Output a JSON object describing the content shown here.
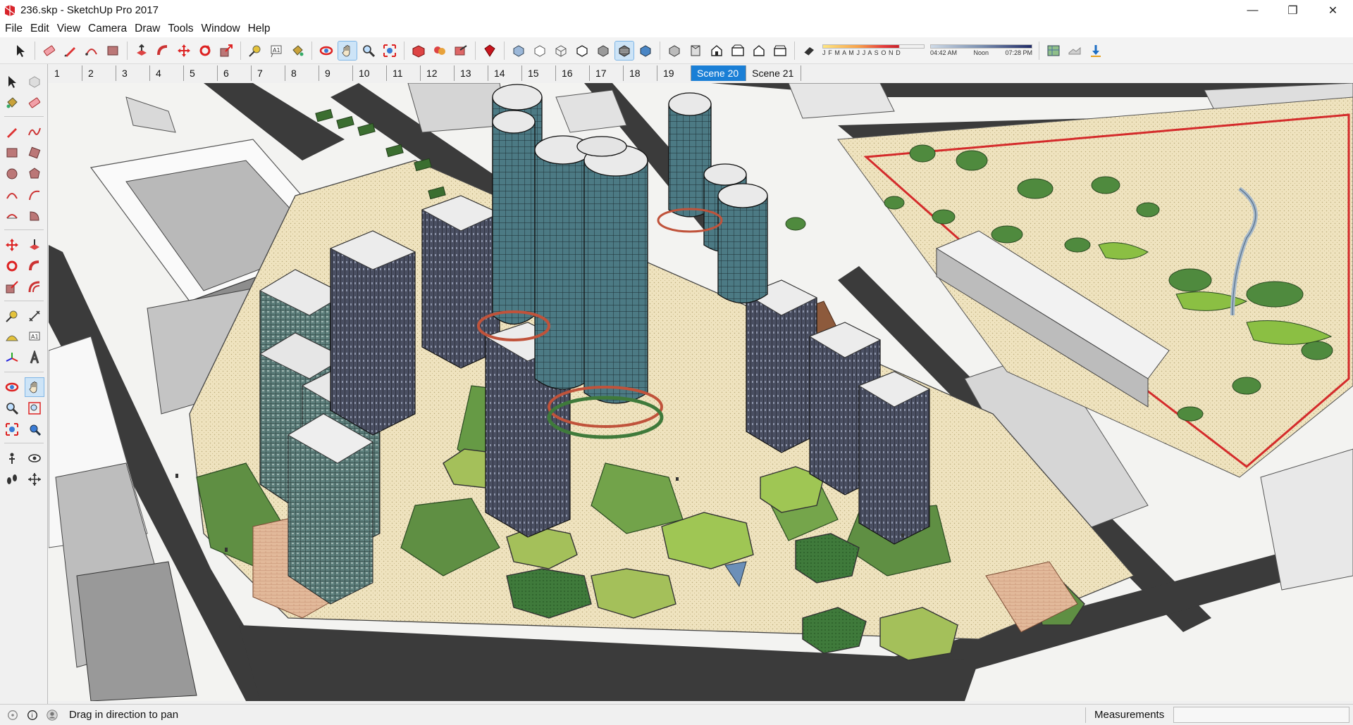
{
  "window": {
    "title": "236.skp - SketchUp Pro 2017",
    "minimize_glyph": "—",
    "maximize_glyph": "❐",
    "close_glyph": "✕"
  },
  "menu": [
    "File",
    "Edit",
    "View",
    "Camera",
    "Draw",
    "Tools",
    "Window",
    "Help"
  ],
  "shadows": {
    "months_label": "J F M A M J J A S O N D",
    "time_start": "04:42 AM",
    "time_mid": "Noon",
    "time_end": "07:28 PM"
  },
  "scenes": [
    {
      "label": "1"
    },
    {
      "label": "2"
    },
    {
      "label": "3"
    },
    {
      "label": "4"
    },
    {
      "label": "5"
    },
    {
      "label": "6"
    },
    {
      "label": "7"
    },
    {
      "label": "8"
    },
    {
      "label": "9"
    },
    {
      "label": "10"
    },
    {
      "label": "11"
    },
    {
      "label": "12"
    },
    {
      "label": "13"
    },
    {
      "label": "14"
    },
    {
      "label": "15"
    },
    {
      "label": "16"
    },
    {
      "label": "17"
    },
    {
      "label": "18"
    },
    {
      "label": "19"
    },
    {
      "label": "Scene 20",
      "active": true
    },
    {
      "label": "Scene 21"
    }
  ],
  "status": {
    "hint": "Drag in direction to pan",
    "measurements_label": "Measurements",
    "measurements_value": ""
  },
  "colors": {
    "accent": "#1a7fd6",
    "glass": "#4e7d86",
    "paving": "#efe3bf",
    "lawn": "#6a9a43",
    "road": "#3a3a3a"
  }
}
